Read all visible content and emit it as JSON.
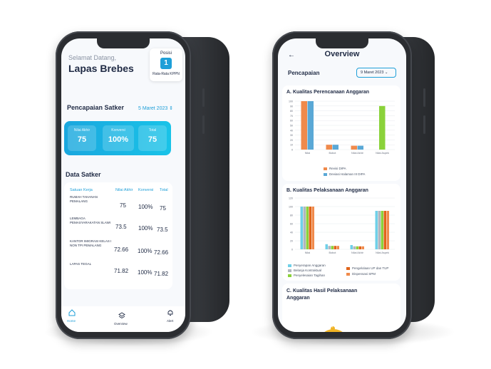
{
  "left_screen": {
    "greeting": "Selamat Datang,",
    "name": "Lapas Brebes",
    "rank": {
      "label": "Posisi",
      "value": "1",
      "sub": "Rata-Rata KPPN"
    },
    "achievement": {
      "title": "Pencapaian Satker",
      "date": "5 Maret 2023 ⇕",
      "tiles": [
        {
          "label": "Nilai Akhir",
          "value": "75"
        },
        {
          "label": "Konversi",
          "value": "100%"
        },
        {
          "label": "Total",
          "value": "75"
        }
      ]
    },
    "data_satker": {
      "title": "Data Satker",
      "headers": [
        "Satuan Kerja",
        "Nilai Akhir",
        "Konversi",
        "Total"
      ],
      "rows": [
        {
          "name": "RUMAH TAHANAN PEMALANG",
          "nilai": "75",
          "konversi": "100%",
          "total": "75"
        },
        {
          "name": "LEMBAGA PEMASYARAKATAN SLAWI",
          "nilai": "73.5",
          "konversi": "100%",
          "total": "73.5"
        },
        {
          "name": "KANTOR IMIGRASI KELAS I NON TPI PEMALANG",
          "nilai": "72.66",
          "konversi": "100%",
          "total": "72.66"
        },
        {
          "name": "LAPAS TEGAL",
          "nilai": "71.82",
          "konversi": "100%",
          "total": "71.82"
        }
      ]
    },
    "tabbar": {
      "home": "Home",
      "overview": "Overview",
      "alert": "Alert"
    }
  },
  "right_screen": {
    "back_icon": "←",
    "title": "Overview",
    "label": "Pencapaian",
    "date": "9 Maret 2023 ⌄",
    "section_a": "A. Kualitas Perencanaan Anggaran",
    "section_b": "B. Kualitas Pelaksanaan Anggaran",
    "section_c": "C. Kualitas Hasil Pelaksanaan Anggaran",
    "gauge_marker": "75"
  },
  "colors": {
    "accent": "#1e9fd8",
    "orange": "#f08a4b",
    "blue": "#5aa8d6",
    "green": "#8ad23a",
    "cyan": "#6fd0e8",
    "gray": "#b0b6bf",
    "dark_orange": "#e0641a",
    "yellow": "#f0b324"
  },
  "chart_data": [
    {
      "type": "bar",
      "title": "A. Kualitas Perencanaan Anggaran",
      "categories": [
        "Nilai",
        "Bobot",
        "Nilai Akhir",
        "Nilai Aspek"
      ],
      "ylim": [
        0,
        100
      ],
      "yticks": [
        "0",
        "10",
        "20",
        "30",
        "40",
        "50",
        "60",
        "70",
        "80",
        "90",
        "100"
      ],
      "series": [
        {
          "name": "Revisi DIPA",
          "color": "#f08a4b",
          "values": [
            100,
            10,
            8,
            null
          ]
        },
        {
          "name": "Deviasi Halaman III DIPA",
          "color": "#5aa8d6",
          "values": [
            100,
            10,
            8,
            null
          ]
        },
        {
          "name": "",
          "color": "#8ad23a",
          "values": [
            null,
            null,
            null,
            90
          ]
        }
      ]
    },
    {
      "type": "bar",
      "title": "B. Kualitas Pelaksanaan Anggaran",
      "categories": [
        "Nilai",
        "Bobot",
        "Nilai Akhir",
        "Nilai Aspek"
      ],
      "ylim": [
        0,
        120
      ],
      "yticks": [
        "0",
        "20",
        "40",
        "60",
        "80",
        "100",
        "120"
      ],
      "series": [
        {
          "name": "Penyerapan Anggaran",
          "color": "#6fd0e8",
          "values": [
            100,
            12,
            10,
            90
          ]
        },
        {
          "name": "Belanja Kontraktual",
          "color": "#b0b6bf",
          "values": [
            100,
            8,
            7,
            90
          ]
        },
        {
          "name": "Penyelesaian Tagihan",
          "color": "#8ad23a",
          "values": [
            100,
            8,
            7,
            90
          ]
        },
        {
          "name": "Pengelolaan UP dan TUP",
          "color": "#e0641a",
          "values": [
            100,
            8,
            7,
            90
          ]
        },
        {
          "name": "Dispensasi SPM",
          "color": "#f08a4b",
          "values": [
            100,
            8,
            7,
            90
          ]
        }
      ]
    }
  ]
}
